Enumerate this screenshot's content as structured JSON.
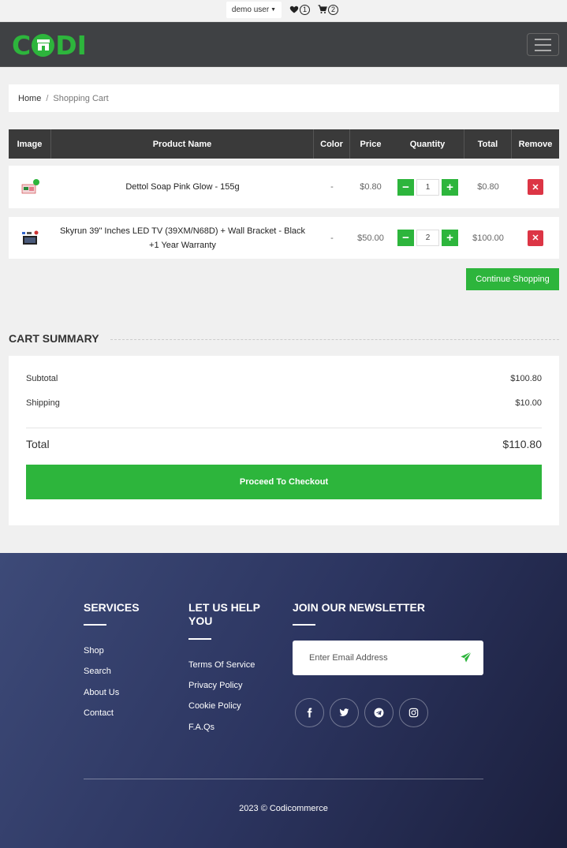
{
  "topbar": {
    "user_label": "demo user",
    "wishlist_count": "1",
    "cart_count": "2"
  },
  "header": {
    "logo_text_left": "C",
    "logo_text_right": "DI"
  },
  "breadcrumb": {
    "home": "Home",
    "separator": "/",
    "current": "Shopping Cart"
  },
  "table": {
    "headers": [
      "Image",
      "Product Name",
      "Color",
      "Price",
      "Quantity",
      "Total",
      "Remove"
    ],
    "rows": [
      {
        "name": "Dettol Soap Pink Glow - 155g",
        "color": "-",
        "price": "$0.80",
        "qty": "1",
        "total": "$0.80"
      },
      {
        "name": "Skyrun 39\" Inches LED TV (39XM/N68D) + Wall Bracket - Black +1 Year Warranty",
        "color": "-",
        "price": "$50.00",
        "qty": "2",
        "total": "$100.00"
      }
    ],
    "continue_label": "Continue Shopping"
  },
  "summary": {
    "title": "CART SUMMARY",
    "subtotal_label": "Subtotal",
    "subtotal_value": "$100.80",
    "shipping_label": "Shipping",
    "shipping_value": "$10.00",
    "total_label": "Total",
    "total_value": "$110.80",
    "checkout_label": "Proceed To Checkout"
  },
  "footer": {
    "services_title": "SERVICES",
    "services_links": [
      "Shop",
      "Search",
      "About Us",
      "Contact"
    ],
    "help_title_line1": "LET US HELP",
    "help_title_line2": "YOU",
    "help_links": [
      "Terms Of Service",
      "Privacy Policy",
      "Cookie Policy",
      "F.A.Qs"
    ],
    "newsletter_title": "JOIN OUR NEWSLETTER",
    "newsletter_placeholder": "Enter Email Address",
    "social_icons": [
      "facebook-icon",
      "twitter-icon",
      "telegram-icon",
      "instagram-icon"
    ],
    "copyright": "2023 © Codicommerce"
  },
  "colors": {
    "accent": "#2db53c",
    "danger": "#dc3545",
    "header_bg": "#3f4144"
  }
}
